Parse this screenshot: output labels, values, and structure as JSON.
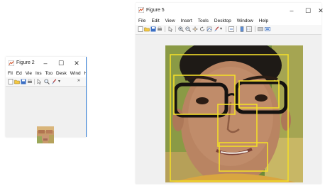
{
  "figure2": {
    "title": "Figure 2",
    "controls": {
      "minimize": "–",
      "maximize": "☐",
      "close": "✕"
    },
    "menu": [
      "Fil",
      "Ed",
      "Vie",
      "Ins",
      "Too",
      "Desk",
      "Wind",
      "He",
      "»"
    ],
    "toolbar_overflow": "»"
  },
  "figure5": {
    "title": "Figure 5",
    "controls": {
      "minimize": "–",
      "maximize": "☐",
      "close": "✕"
    },
    "menu": [
      "File",
      "Edit",
      "View",
      "Insert",
      "Tools",
      "Desktop",
      "Window",
      "Help"
    ]
  },
  "colors": {
    "detection_box": "#f2dd2a",
    "window_bg": "#f0f0f0",
    "accent_border": "#2e7bd6"
  },
  "icons": {
    "toolbar_figure5": [
      "new-figure-icon",
      "open-icon",
      "save-icon",
      "print-icon",
      "pointer-icon",
      "zoom-in-icon",
      "zoom-out-icon",
      "pan-icon",
      "rotate-icon",
      "data-cursor-icon",
      "brush-icon",
      "link-plot-icon",
      "colorbar-icon",
      "legend-icon",
      "hide-plot-tools-icon",
      "show-plot-tools-icon"
    ],
    "toolbar_figure2": [
      "new-figure-icon",
      "open-icon",
      "save-icon",
      "print-icon",
      "pointer-icon",
      "zoom-in-icon",
      "brush-icon"
    ]
  },
  "detections": {
    "description_labels": [
      "face",
      "left-eye",
      "right-eye",
      "nose",
      "mouth"
    ]
  }
}
